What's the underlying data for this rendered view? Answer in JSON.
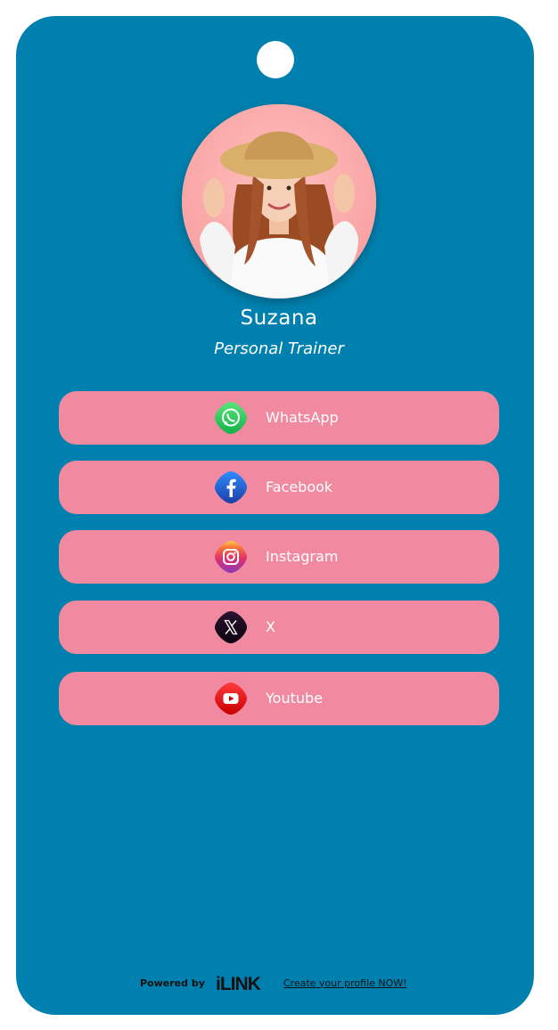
{
  "profile": {
    "name": "Suzana",
    "title": "Personal Trainer"
  },
  "links": [
    {
      "label": "WhatsApp",
      "icon": "whatsapp-icon"
    },
    {
      "label": "Facebook",
      "icon": "facebook-icon"
    },
    {
      "label": "Instagram",
      "icon": "instagram-icon"
    },
    {
      "label": "X",
      "icon": "x-icon"
    },
    {
      "label": "Youtube",
      "icon": "youtube-icon"
    }
  ],
  "footer": {
    "powered_by": "Powered by",
    "brand": "iLINK",
    "cta": "Create your profile NOW!"
  },
  "colors": {
    "card_background": "#0080AE",
    "button_background": "#F18AA1",
    "text": "#FFFFFF"
  }
}
